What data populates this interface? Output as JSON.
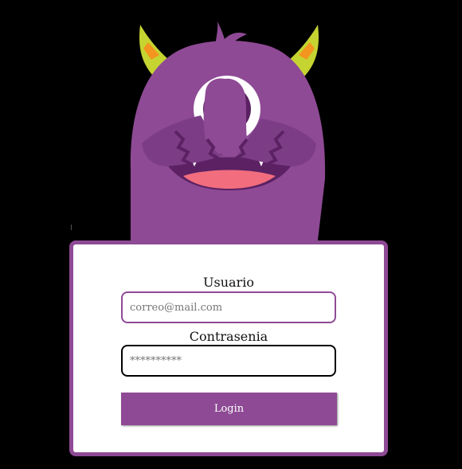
{
  "colors": {
    "background": "#000000",
    "accent": "#8e4a95",
    "card": "#ffffff"
  },
  "mascot": {
    "icon": "purple-cyclops-monster-icon"
  },
  "login_form": {
    "username_label": "Usuario",
    "username_placeholder": "correo@mail.com",
    "username_value": "",
    "password_label": "Contrasenia",
    "password_placeholder": "**********",
    "password_value": "",
    "login_button": "Login"
  }
}
